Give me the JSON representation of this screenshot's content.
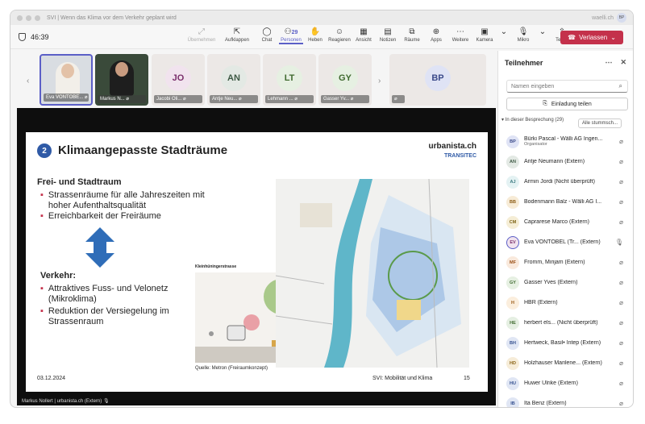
{
  "titlebar": {
    "title": "SVI | Wenn das Klima vor dem Verkehr geplant wird",
    "domain": "waelli.ch",
    "avatar": "BP"
  },
  "toolbar": {
    "timer": "46:39",
    "people_count": "29",
    "tools": [
      {
        "label": "Übernehmen",
        "icon": "⤢"
      },
      {
        "label": "Aufklappen",
        "icon": "⇱"
      },
      {
        "label": "Chat",
        "icon": "◯"
      },
      {
        "label": "Personen",
        "icon": "⚇"
      },
      {
        "label": "Heben",
        "icon": "✋"
      },
      {
        "label": "Reagieren",
        "icon": "☺"
      },
      {
        "label": "Ansicht",
        "icon": "▦"
      },
      {
        "label": "Notizen",
        "icon": "▤"
      },
      {
        "label": "Räume",
        "icon": "⧉"
      },
      {
        "label": "Apps",
        "icon": "⊕"
      },
      {
        "label": "Weitere",
        "icon": "⋯"
      }
    ],
    "camera": "Kamera",
    "mic": "Mikro",
    "share": "Teilen",
    "leave": "Verlassen"
  },
  "tiles": [
    {
      "name": "Eva VONTOBE...",
      "initials": ""
    },
    {
      "name": "Markus N...",
      "initials": ""
    },
    {
      "name": "Jacobi Oli...",
      "initials": "JO"
    },
    {
      "name": "Antje Neu...",
      "initials": "AN"
    },
    {
      "name": "Lehmann ...",
      "initials": "LT"
    },
    {
      "name": "Gasser Yv...",
      "initials": "GY"
    },
    {
      "name": "",
      "initials": "BP"
    }
  ],
  "slide": {
    "num": "2",
    "title": "Klimaangepasste Stadträume",
    "brand": "urbanista.ch",
    "brand2": "TRANSITEC",
    "h1": "Frei- und Stadtraum",
    "b1": [
      "Strassenräume für alle Jahreszeiten mit hoher Aufenthaltsqualität",
      "Erreichbarkeit der Freiräume"
    ],
    "h2": "Verkehr:",
    "b2": [
      "Attraktives Fuss- und Velonetz (Mikroklima)",
      "Reduktion der Versiegelung im Strassenraum"
    ],
    "section_label": "Kleinhüningerstrasse",
    "source": "Quelle: Metron (Freiraumkonzept)",
    "date": "03.12.2024",
    "footer": "SVI: Mobilität und Klima",
    "page": "15"
  },
  "presenter": "Markus Nollert | urbanista.ch (Extern)",
  "panel": {
    "title": "Teilnehmer",
    "search_placeholder": "Namen eingeben",
    "invite": "Einladung teilen",
    "section": "In dieser Besprechung (29)",
    "mute_all": "Alle stummsch...",
    "people": [
      {
        "initials": "BP",
        "name": "Bürki Pascal - Wälli AG Ingen...",
        "sub": "Organisator",
        "bg": "#dfe3f5",
        "fg": "#3b4a8a"
      },
      {
        "initials": "AN",
        "name": "Antje Neumann (Extern)",
        "sub": "",
        "bg": "#e3e9e4",
        "fg": "#3e5a45"
      },
      {
        "initials": "AJ",
        "name": "Armin Jordi (Nicht überprüft)",
        "sub": "",
        "bg": "#e4f2f3",
        "fg": "#3c7a80"
      },
      {
        "initials": "BB",
        "name": "Bodenmann Balz - Wälli AG I...",
        "sub": "",
        "bg": "#f7ebd6",
        "fg": "#8a5a12"
      },
      {
        "initials": "CM",
        "name": "Caprarese Marco (Extern)",
        "sub": "",
        "bg": "#f5edd5",
        "fg": "#7d6317"
      },
      {
        "initials": "EV",
        "name": "Eva VONTOBEL (Tr...  (Extern)",
        "sub": "",
        "bg": "#f1e3ee",
        "fg": "#7a2e6b"
      },
      {
        "initials": "MF",
        "name": "Fromm, Mirijam (Extern)",
        "sub": "",
        "bg": "#f9e9dc",
        "fg": "#9a4f16"
      },
      {
        "initials": "GY",
        "name": "Gasser Yves (Extern)",
        "sub": "",
        "bg": "#e6f0e2",
        "fg": "#3f6a2f"
      },
      {
        "initials": "H",
        "name": "HBR (Extern)",
        "sub": "",
        "bg": "#fbeedd",
        "fg": "#9a5a16"
      },
      {
        "initials": "HE",
        "name": "herbert els...  (Nicht überprüft)",
        "sub": "",
        "bg": "#e5efe2",
        "fg": "#3f6a2f"
      },
      {
        "initials": "BH",
        "name": "Hertweck, Basil• Intep (Extern)",
        "sub": "",
        "bg": "#e0e6f4",
        "fg": "#35508f"
      },
      {
        "initials": "HD",
        "name": "Holzhauser Marilene...  (Extern)",
        "sub": "",
        "bg": "#f6ecd8",
        "fg": "#8a6317"
      },
      {
        "initials": "HU",
        "name": "Huwer Ulrike (Extern)",
        "sub": "",
        "bg": "#e0e6f4",
        "fg": "#35508f"
      },
      {
        "initials": "IB",
        "name": "Ita Benz (Extern)",
        "sub": "",
        "bg": "#e0e6f4",
        "fg": "#35508f"
      }
    ]
  }
}
